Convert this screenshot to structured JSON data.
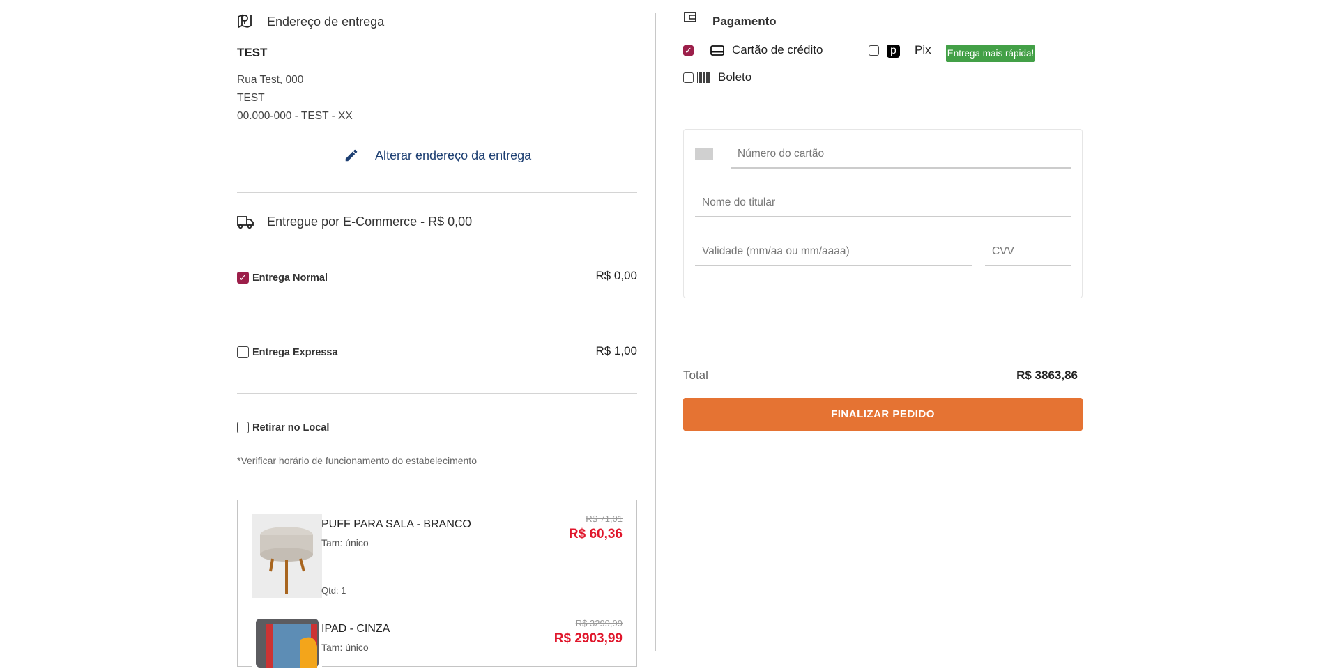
{
  "address": {
    "title": "Endereço de entrega",
    "name": "TEST",
    "line1": "Rua Test, 000",
    "line2": "TEST",
    "line3": "00.000-000 - TEST - XX",
    "change_label": "Alterar endereço da entrega"
  },
  "shipping": {
    "title": "Entregue por E-Commerce - R$ 0,00",
    "options": [
      {
        "label": "Entrega Normal",
        "price": "R$ 0,00",
        "checked": true
      },
      {
        "label": "Entrega Expressa",
        "price": "R$ 1,00",
        "checked": false
      },
      {
        "label": "Retirar no Local",
        "checked": false
      }
    ],
    "note": "*Verificar horário de funcionamento do estabelecimento"
  },
  "products": [
    {
      "name": "PUFF PARA SALA - BRANCO",
      "size": "Tam: único",
      "qty": "Qtd: 1",
      "old_price": "R$ 71,01",
      "price": "R$ 60,36"
    },
    {
      "name": "IPAD - CINZA",
      "size": "Tam: único",
      "old_price": "R$ 3299,99",
      "price": "R$ 2903,99"
    }
  ],
  "payment": {
    "title": "Pagamento",
    "methods": [
      {
        "label": "Cartão de crédito",
        "icon": "credit-card-icon",
        "checked": true
      },
      {
        "label": "Pix",
        "icon": "pix-icon",
        "checked": false
      },
      {
        "label": "Boleto",
        "icon": "barcode-icon",
        "checked": false
      }
    ],
    "pix_badge": "Entrega mais rápida!",
    "card_form": {
      "number_placeholder": "Número do cartão",
      "holder_placeholder": "Nome do titular",
      "expiry_placeholder": "Validade (mm/aa ou mm/aaaa)",
      "cvv_placeholder": "CVV"
    },
    "total_label": "Total",
    "total_value": "R$ 3863,86",
    "submit_label": "FINALIZAR PEDIDO"
  },
  "colors": {
    "accent": "#9c1f4a",
    "button": "#e57333",
    "badge": "#43a047",
    "link": "#1d3f72",
    "sale": "#e0162b"
  }
}
